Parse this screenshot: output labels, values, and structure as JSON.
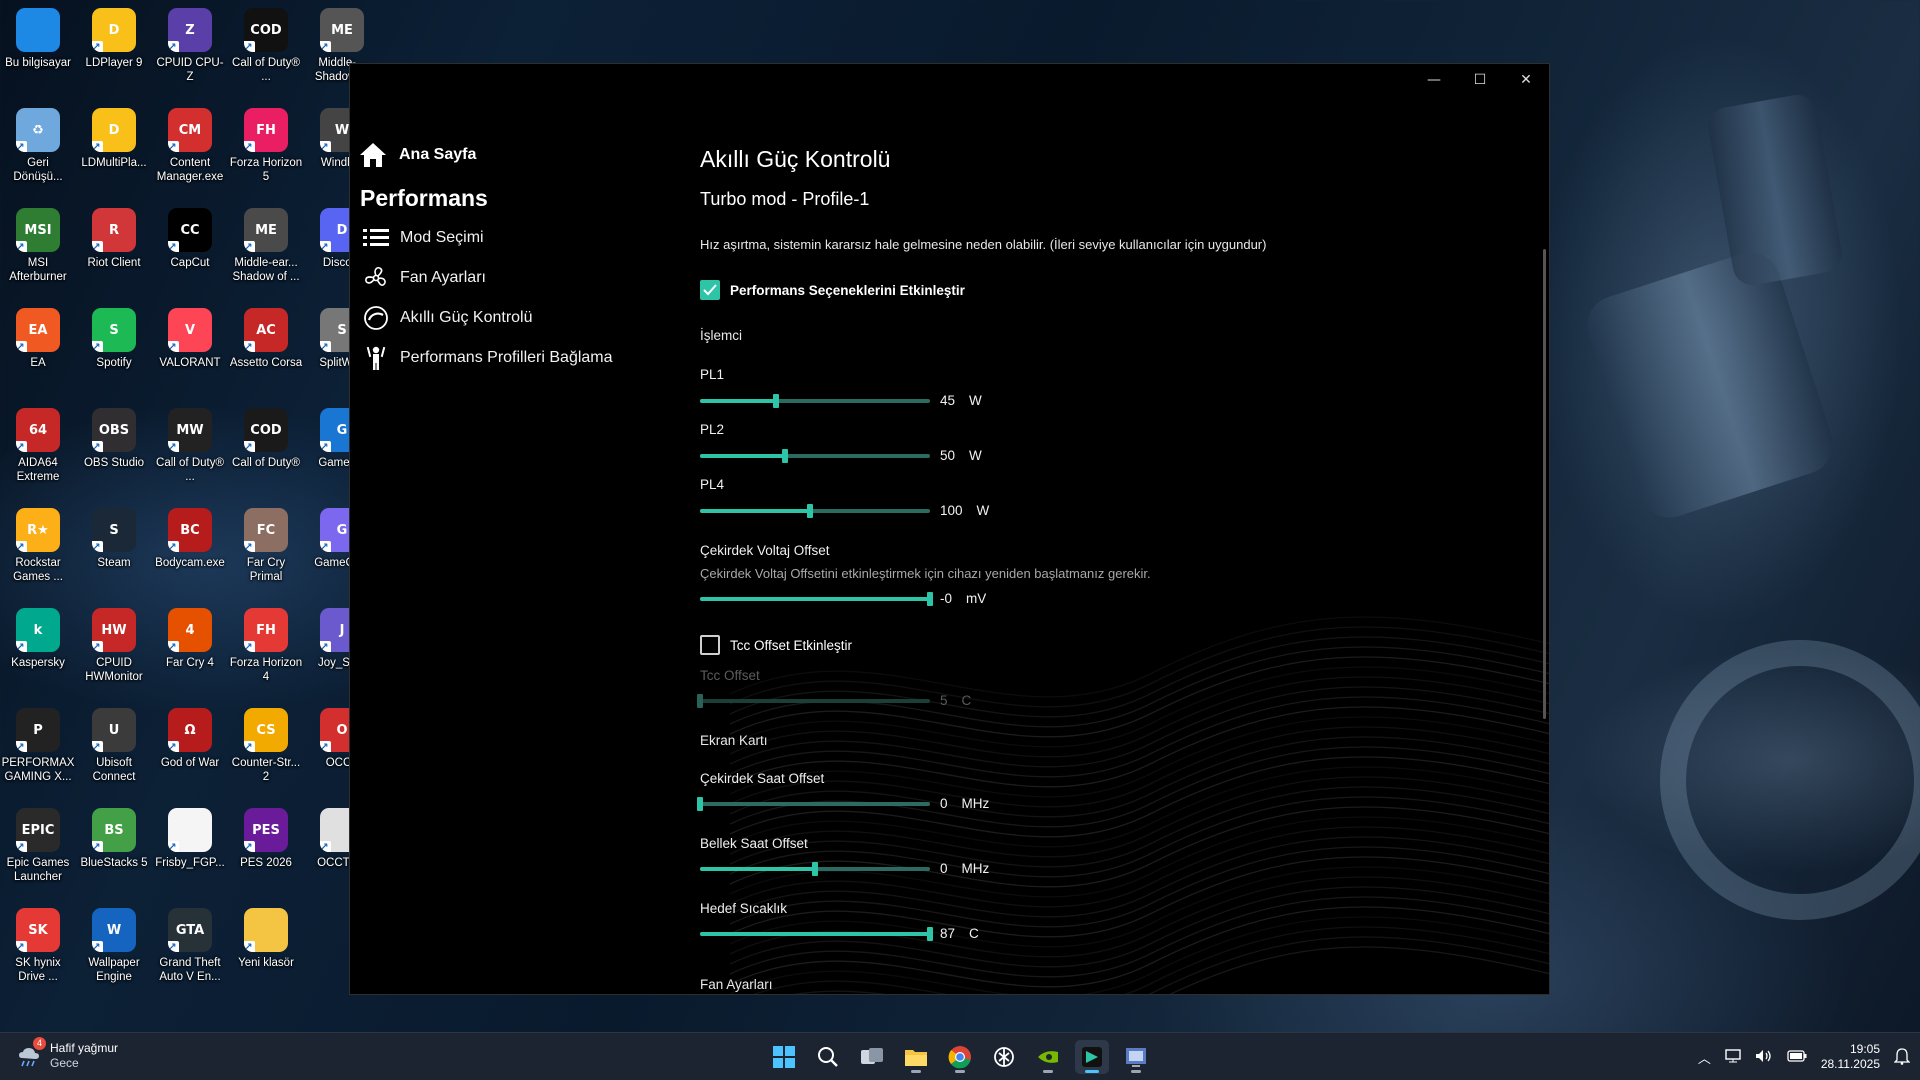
{
  "desktop": {
    "icons": [
      {
        "label": "Bu bilgisayar",
        "icon": "monitor-icon",
        "color": "#1e88e5",
        "glyph": ""
      },
      {
        "label": "LDPlayer 9",
        "icon": "ldplayer-icon",
        "color": "#f9c01a",
        "glyph": "D"
      },
      {
        "label": "CPUID CPU-Z",
        "icon": "cpuz-icon",
        "color": "#5b3fa8",
        "glyph": "Z"
      },
      {
        "label": "Call of Duty® ...",
        "icon": "cod-icon",
        "color": "#111111",
        "glyph": "COD"
      },
      {
        "label": "Middle-... Shadow ...",
        "icon": "middle-earth-icon",
        "color": "#555555",
        "glyph": "ME"
      },
      {
        "label": "Geri Dönüşü...",
        "icon": "recycle-bin-icon",
        "color": "#6fa8dc",
        "glyph": "♻"
      },
      {
        "label": "LDMultiPla...",
        "icon": "ldmultiplayer-icon",
        "color": "#f9c01a",
        "glyph": "D"
      },
      {
        "label": "Content Manager.exe",
        "icon": "content-manager-icon",
        "color": "#d32f2f",
        "glyph": "CM"
      },
      {
        "label": "Forza Horizon 5",
        "icon": "forza5-icon",
        "color": "#e91e63",
        "glyph": "FH"
      },
      {
        "label": "Windh...",
        "icon": "windhawk-icon",
        "color": "#444444",
        "glyph": "W"
      },
      {
        "label": "MSI Afterburner",
        "icon": "afterburner-icon",
        "color": "#2e7d32",
        "glyph": "MSI"
      },
      {
        "label": "Riot Client",
        "icon": "riot-icon",
        "color": "#d13639",
        "glyph": "R"
      },
      {
        "label": "CapCut",
        "icon": "capcut-icon",
        "color": "#000000",
        "glyph": "CC"
      },
      {
        "label": "Middle-ear... Shadow of ...",
        "icon": "middle-earth2-icon",
        "color": "#4a4a4a",
        "glyph": "ME"
      },
      {
        "label": "Disco...",
        "icon": "discord-icon",
        "color": "#5865f2",
        "glyph": "D"
      },
      {
        "label": "EA",
        "icon": "ea-icon",
        "color": "#f05a22",
        "glyph": "EA"
      },
      {
        "label": "Spotify",
        "icon": "spotify-icon",
        "color": "#1db954",
        "glyph": "S"
      },
      {
        "label": "VALORANT",
        "icon": "valorant-icon",
        "color": "#fd4556",
        "glyph": "V"
      },
      {
        "label": "Assetto Corsa",
        "icon": "assetto-icon",
        "color": "#c62828",
        "glyph": "AC"
      },
      {
        "label": "SplitWi...",
        "icon": "splitwire-icon",
        "color": "#777777",
        "glyph": "S"
      },
      {
        "label": "AIDA64 Extreme",
        "icon": "aida64-icon",
        "color": "#c62828",
        "glyph": "64"
      },
      {
        "label": "OBS Studio",
        "icon": "obs-icon",
        "color": "#302e31",
        "glyph": "OBS"
      },
      {
        "label": "Call of Duty® ...",
        "icon": "cod-mw-icon",
        "color": "#222222",
        "glyph": "MW"
      },
      {
        "label": "Call of Duty®",
        "icon": "cod2-icon",
        "color": "#1a1a1a",
        "glyph": "COD"
      },
      {
        "label": "GameL...",
        "icon": "gamelauncher-icon",
        "color": "#1976d2",
        "glyph": "G"
      },
      {
        "label": "Rockstar Games ...",
        "icon": "rockstar-icon",
        "color": "#fcaf17",
        "glyph": "R★"
      },
      {
        "label": "Steam",
        "icon": "steam-icon",
        "color": "#1b2838",
        "glyph": "S"
      },
      {
        "label": "Bodycam.exe",
        "icon": "bodycam-icon",
        "color": "#b71c1c",
        "glyph": "BC"
      },
      {
        "label": "Far Cry Primal",
        "icon": "farcry-primal-icon",
        "color": "#8d6e63",
        "glyph": "FC"
      },
      {
        "label": "GameCo...",
        "icon": "gamecontroller-icon",
        "color": "#7b68ee",
        "glyph": "G"
      },
      {
        "label": "Kaspersky",
        "icon": "kaspersky-icon",
        "color": "#00a88e",
        "glyph": "k"
      },
      {
        "label": "CPUID HWMonitor",
        "icon": "hwmonitor-icon",
        "color": "#c62828",
        "glyph": "HW"
      },
      {
        "label": "Far Cry 4",
        "icon": "farcry4-icon",
        "color": "#e65100",
        "glyph": "4"
      },
      {
        "label": "Forza Horizon 4",
        "icon": "forza4-icon",
        "color": "#e53935",
        "glyph": "FH"
      },
      {
        "label": "Joy_Se...",
        "icon": "joystick-icon",
        "color": "#6a5acd",
        "glyph": "J"
      },
      {
        "label": "PERFORMAX GAMING X...",
        "icon": "performax-icon",
        "color": "#222222",
        "glyph": "P"
      },
      {
        "label": "Ubisoft Connect",
        "icon": "ubisoft-icon",
        "color": "#3b3b3b",
        "glyph": "U"
      },
      {
        "label": "God of War",
        "icon": "godofwar-icon",
        "color": "#b71c1c",
        "glyph": "Ω"
      },
      {
        "label": "Counter-Str... 2",
        "icon": "cs2-icon",
        "color": "#f2a900",
        "glyph": "CS"
      },
      {
        "label": "OCCT",
        "icon": "occt-icon",
        "color": "#d32f2f",
        "glyph": "O"
      },
      {
        "label": "Epic Games Launcher",
        "icon": "epic-icon",
        "color": "#2a2a2a",
        "glyph": "EPIC"
      },
      {
        "label": "BlueStacks 5",
        "icon": "bluestacks-icon",
        "color": "#43a047",
        "glyph": "BS"
      },
      {
        "label": "Frisby_FGP...",
        "icon": "file-icon",
        "color": "#f5f5f5",
        "glyph": ""
      },
      {
        "label": "PES 2026",
        "icon": "pes-icon",
        "color": "#6a1b9a",
        "glyph": "PES"
      },
      {
        "label": "OCCT.c...",
        "icon": "file2-icon",
        "color": "#e0e0e0",
        "glyph": ""
      },
      {
        "label": "SK hynix Drive ...",
        "icon": "skhynix-icon",
        "color": "#e53935",
        "glyph": "SK"
      },
      {
        "label": "Wallpaper Engine",
        "icon": "wallpaper-engine-icon",
        "color": "#1565c0",
        "glyph": "W"
      },
      {
        "label": "Grand Theft Auto V En...",
        "icon": "gtav-icon",
        "color": "#263238",
        "glyph": "GTA"
      },
      {
        "label": "Yeni klasör",
        "icon": "folder-icon",
        "color": "#f4c542",
        "glyph": ""
      }
    ]
  },
  "window": {
    "controls": {
      "minimize": "—",
      "maximize": "☐",
      "close": "✕"
    },
    "sidebar": {
      "home_label": "Ana Sayfa",
      "section_title": "Performans",
      "items": [
        {
          "label": "Mod Seçimi",
          "icon": "list-icon"
        },
        {
          "label": "Fan Ayarları",
          "icon": "fan-icon"
        },
        {
          "label": "Akıllı Güç Kontrolü",
          "icon": "power-control-icon"
        },
        {
          "label": "Performans Profilleri Bağlama",
          "icon": "profile-link-icon"
        }
      ]
    },
    "content": {
      "title": "Akıllı Güç Kontrolü",
      "subtitle": "Turbo mod - Profile-1",
      "warning": "Hız aşırtma, sistemin kararsız hale gelmesine neden olabilir. (İleri seviye kullanıcılar için uygundur)",
      "enable_checkbox": {
        "label": "Performans Seçeneklerini Etkinleştir",
        "checked": true
      },
      "cpu_section": "İşlemci",
      "pl1": {
        "label": "PL1",
        "value": "45",
        "unit": "W",
        "fraction": 0.33
      },
      "pl2": {
        "label": "PL2",
        "value": "50",
        "unit": "W",
        "fraction": 0.37
      },
      "pl4": {
        "label": "PL4",
        "value": "100",
        "unit": "W",
        "fraction": 0.48
      },
      "core_voltage": {
        "label": "Çekirdek Voltaj Offset",
        "desc": "Çekirdek Voltaj Offsetini etkinleştirmek için cihazı yeniden başlatmanız gerekir.",
        "value": "-0",
        "unit": "mV",
        "fraction": 1.0
      },
      "tcc_checkbox": {
        "label": "Tcc Offset Etkinleştir",
        "checked": false
      },
      "tcc": {
        "label": "Tcc Offset",
        "value": "5",
        "unit": "C",
        "fraction": 0.0
      },
      "gpu_section": "Ekran Kartı",
      "core_clock": {
        "label": "Çekirdek Saat Offset",
        "value": "0",
        "unit": "MHz",
        "fraction": 0.0
      },
      "mem_clock": {
        "label": "Bellek Saat Offset",
        "value": "0",
        "unit": "MHz",
        "fraction": 0.5
      },
      "target_temp": {
        "label": "Hedef Sıcaklık",
        "value": "87",
        "unit": "C",
        "fraction": 1.0
      },
      "fan_section": "Fan Ayarları"
    }
  },
  "taskbar": {
    "weather": {
      "title": "Hafif yağmur",
      "subtitle": "Gece",
      "badge": "4"
    },
    "apps": [
      {
        "icon": "windows-start-icon"
      },
      {
        "icon": "search-icon"
      },
      {
        "icon": "task-view-icon"
      },
      {
        "icon": "file-explorer-icon"
      },
      {
        "icon": "chrome-icon"
      },
      {
        "icon": "chatgpt-icon"
      },
      {
        "icon": "nvidia-icon"
      },
      {
        "icon": "msi-center-icon"
      },
      {
        "icon": "cpuz-taskbar-icon"
      }
    ],
    "clock": {
      "time": "19:05",
      "date": "28.11.2025"
    }
  }
}
